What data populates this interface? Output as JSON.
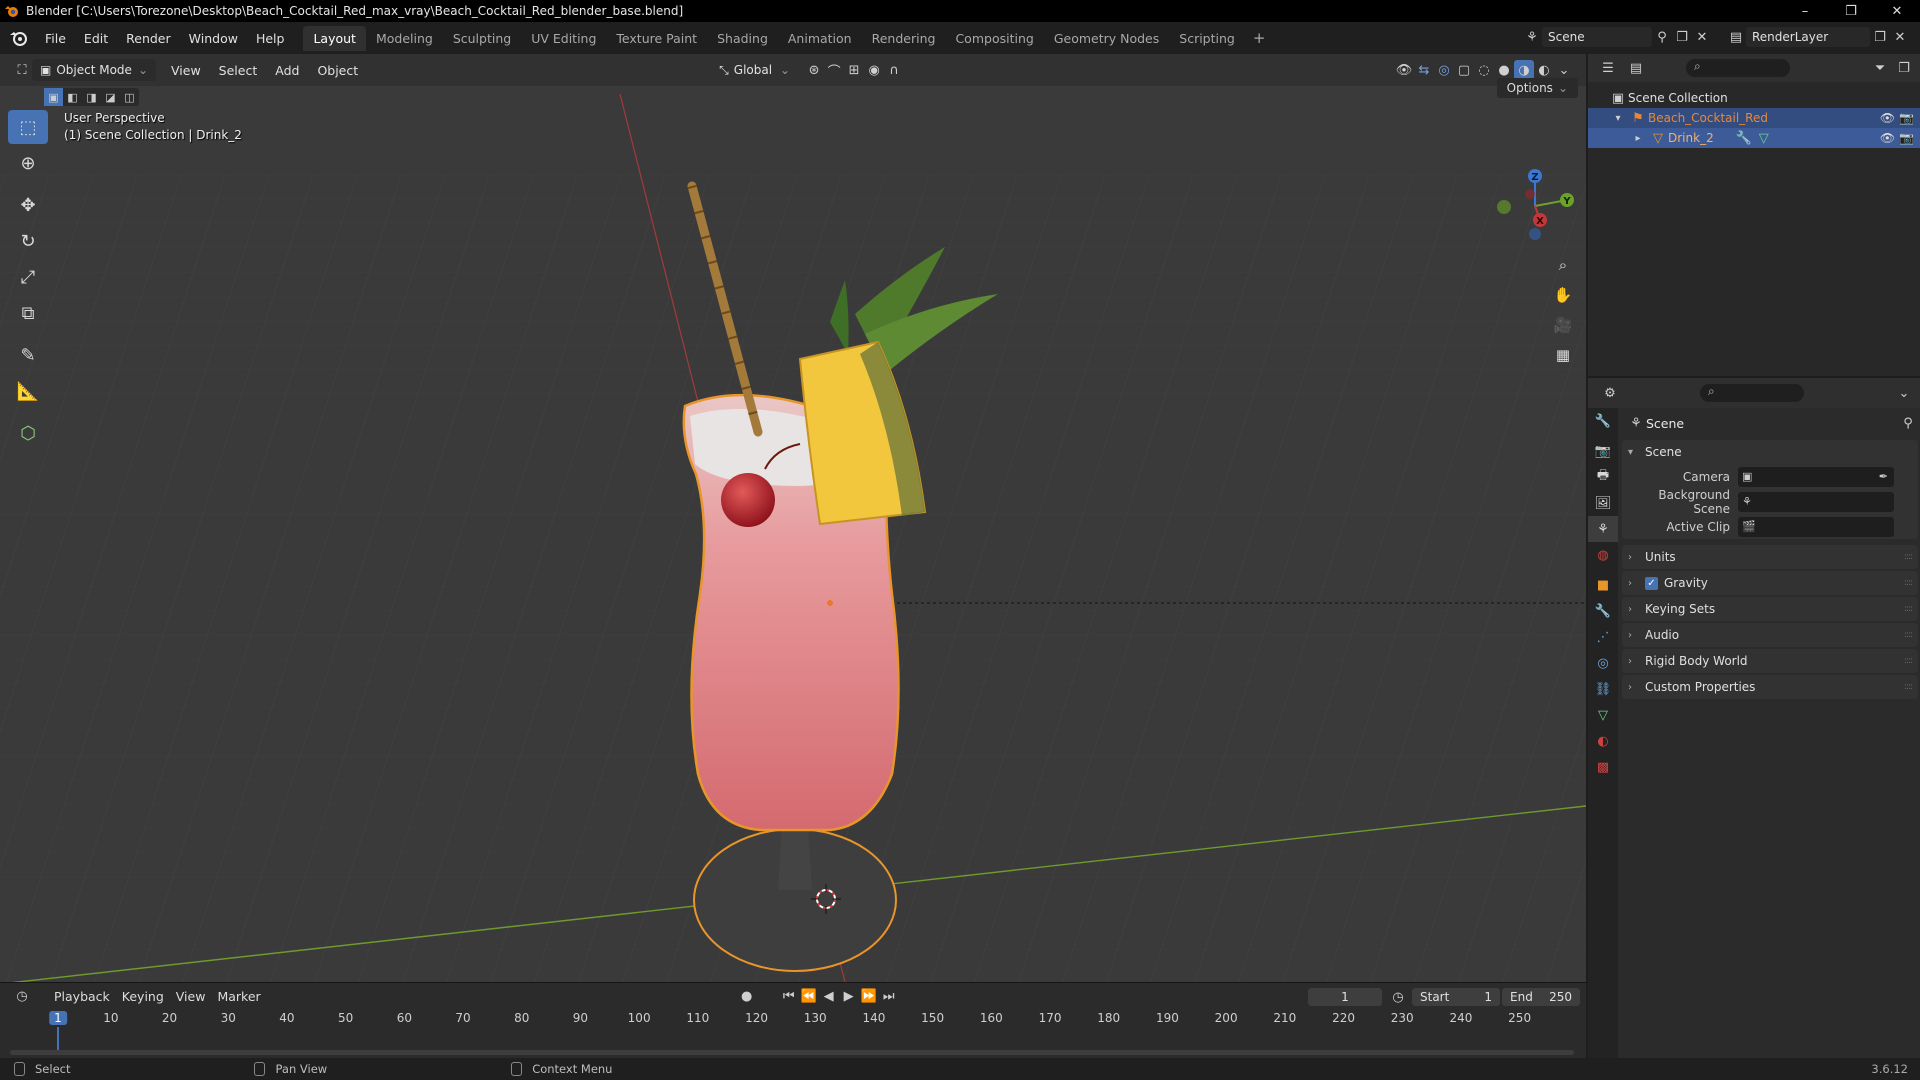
{
  "window": {
    "title": "Blender [C:\\Users\\Torezone\\Desktop\\Beach_Cocktail_Red_max_vray\\Beach_Cocktail_Red_blender_base.blend]",
    "controls": [
      "–",
      "❐",
      "✕"
    ]
  },
  "menu": [
    "File",
    "Edit",
    "Render",
    "Window",
    "Help"
  ],
  "workspaces": [
    "Layout",
    "Modeling",
    "Sculpting",
    "UV Editing",
    "Texture Paint",
    "Shading",
    "Animation",
    "Rendering",
    "Compositing",
    "Geometry Nodes",
    "Scripting"
  ],
  "active_workspace": "Layout",
  "scene_name": "Scene",
  "view_layer": "RenderLayer",
  "viewport": {
    "mode": "Object Mode",
    "menus": [
      "View",
      "Select",
      "Add",
      "Object"
    ],
    "transform_orientation": "Global",
    "options_label": "Options",
    "info_line1": "User Perspective",
    "info_line2": "(1) Scene Collection | Drink_2",
    "gizmo_axes": [
      "X",
      "Y",
      "Z"
    ]
  },
  "outliner": {
    "root": "Scene Collection",
    "collection": "Beach_Cocktail_Red",
    "object": "Drink_2"
  },
  "properties": {
    "context": "Scene",
    "panel_title": "Scene",
    "fields": [
      {
        "label": "Camera",
        "value": ""
      },
      {
        "label": "Background Scene",
        "value": ""
      },
      {
        "label": "Active Clip",
        "value": ""
      }
    ],
    "collapsed_panels": [
      {
        "label": "Units",
        "checkbox": false
      },
      {
        "label": "Gravity",
        "checkbox": true
      },
      {
        "label": "Keying Sets",
        "checkbox": false
      },
      {
        "label": "Audio",
        "checkbox": false
      },
      {
        "label": "Rigid Body World",
        "checkbox": false
      },
      {
        "label": "Custom Properties",
        "checkbox": false
      }
    ]
  },
  "timeline": {
    "menus": [
      "Playback",
      "Keying",
      "View",
      "Marker"
    ],
    "current_frame": "1",
    "start_label": "Start",
    "start": "1",
    "end_label": "End",
    "end": "250",
    "ticks": [
      10,
      20,
      30,
      40,
      50,
      60,
      70,
      80,
      90,
      100,
      110,
      120,
      130,
      140,
      150,
      160,
      170,
      180,
      190,
      200,
      210,
      220,
      230,
      240,
      250
    ]
  },
  "statusbar": {
    "items": [
      "Select",
      "Pan View",
      "Context Menu"
    ],
    "version": "3.6.12"
  },
  "colors": {
    "accent": "#4772b3",
    "selection_outline": "#e8952a",
    "collection_text": "#e8873a",
    "x_axis": "#c2383a",
    "y_axis": "#6aa22a",
    "z_axis": "#3a78d4"
  }
}
